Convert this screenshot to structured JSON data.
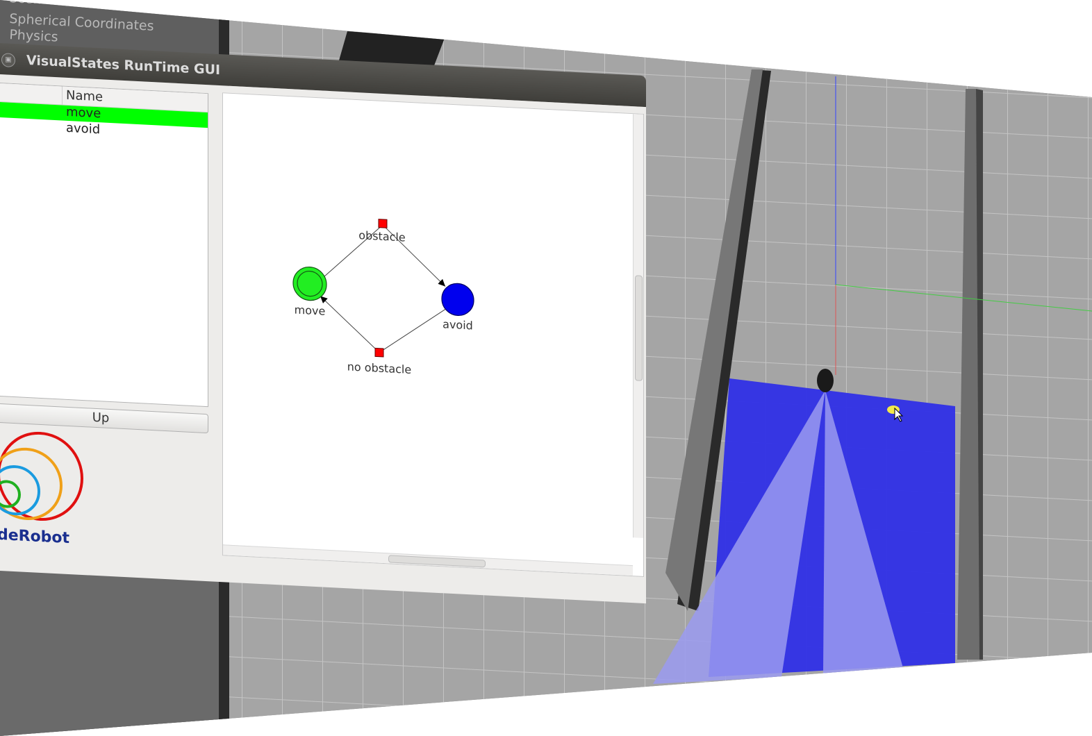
{
  "side_panel": {
    "items": [
      "Scene",
      "Spherical Coordinates",
      "Physics"
    ]
  },
  "window": {
    "title": "VisualStates RunTime GUI"
  },
  "state_list": {
    "column_header": "Name",
    "rows": [
      {
        "label": "move",
        "active": true
      },
      {
        "label": "avoid",
        "active": false
      }
    ]
  },
  "up_button": {
    "label": "Up"
  },
  "logo": {
    "text": "deRobot"
  },
  "diagram": {
    "states": [
      {
        "label": "move",
        "color": "#22ee22",
        "initial": true,
        "active": true
      },
      {
        "label": "avoid",
        "color": "#0000ee",
        "initial": false,
        "active": false
      }
    ],
    "transitions": [
      {
        "label": "obstacle",
        "from": "move",
        "to": "avoid"
      },
      {
        "label": "no obstacle",
        "from": "avoid",
        "to": "move"
      }
    ],
    "transition_color": "#ff0000"
  },
  "colors": {
    "active_row": "#00ff00",
    "laser": "#2f2fe6",
    "logo_text": "#1a2f8f"
  }
}
